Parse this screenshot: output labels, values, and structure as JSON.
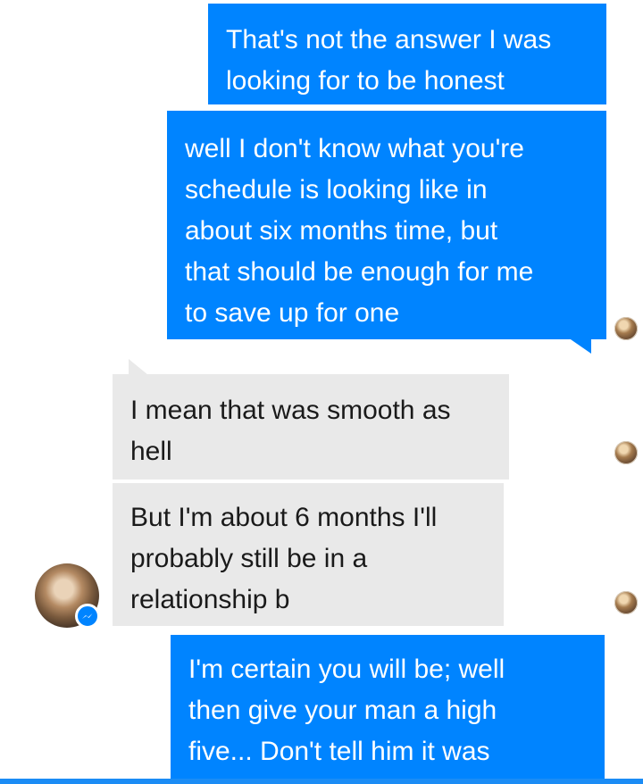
{
  "colors": {
    "outgoing_bubble": "#0084ff",
    "incoming_bubble": "#e9e9e9",
    "badge": "#0084ff"
  },
  "messages": [
    {
      "direction": "outgoing",
      "text": "That's not the answer I was\nlooking for to be honest"
    },
    {
      "direction": "outgoing",
      "text": "well I don't know what you're\nschedule is looking like in\nabout six months time, but\nthat should be enough for me\nto save up for one"
    },
    {
      "direction": "incoming",
      "text": "I mean that was smooth as\nhell"
    },
    {
      "direction": "incoming",
      "text": "But I'm about 6 months I'll\nprobably still be in a\nrelationship b"
    },
    {
      "direction": "outgoing",
      "text": "I'm certain you will be; well\nthen give your man a high\nfive... Don't tell him it was"
    }
  ],
  "icons": {
    "read_receipt": "read-receipt-avatar-icon",
    "contact_avatar": "avatar",
    "badge": "messenger-icon"
  }
}
